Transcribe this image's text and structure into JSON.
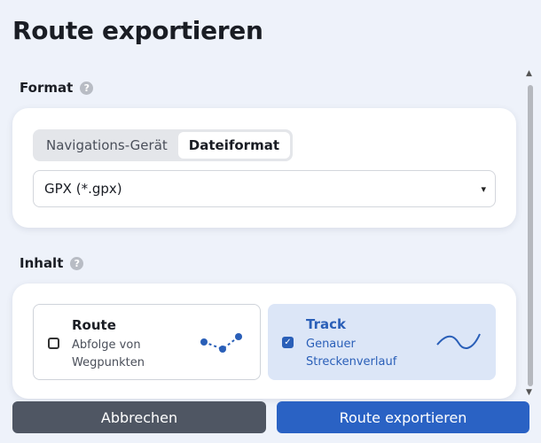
{
  "title": "Route exportieren",
  "format_section": {
    "label": "Format",
    "help": "?",
    "tabs": [
      {
        "label": "Navigations-Gerät",
        "active": false
      },
      {
        "label": "Dateiformat",
        "active": true
      }
    ],
    "select_value": "GPX (*.gpx)",
    "chevron": "▾"
  },
  "content_section": {
    "label": "Inhalt",
    "help": "?",
    "options": [
      {
        "title": "Route",
        "description": "Abfolge von Wegpunkten",
        "checked": false,
        "icon": "route-points-icon"
      },
      {
        "title": "Track",
        "description": "Genauer Streckenverlauf",
        "checked": true,
        "check_glyph": "✓",
        "icon": "track-wave-icon"
      }
    ]
  },
  "scrollbar": {
    "up": "▲",
    "down": "▼"
  },
  "footer": {
    "cancel_label": "Abbrechen",
    "export_label": "Route exportieren"
  },
  "colors": {
    "accent": "#2a62c4",
    "selected_bg": "#dce6f7",
    "cancel_bg": "#4f5663"
  }
}
